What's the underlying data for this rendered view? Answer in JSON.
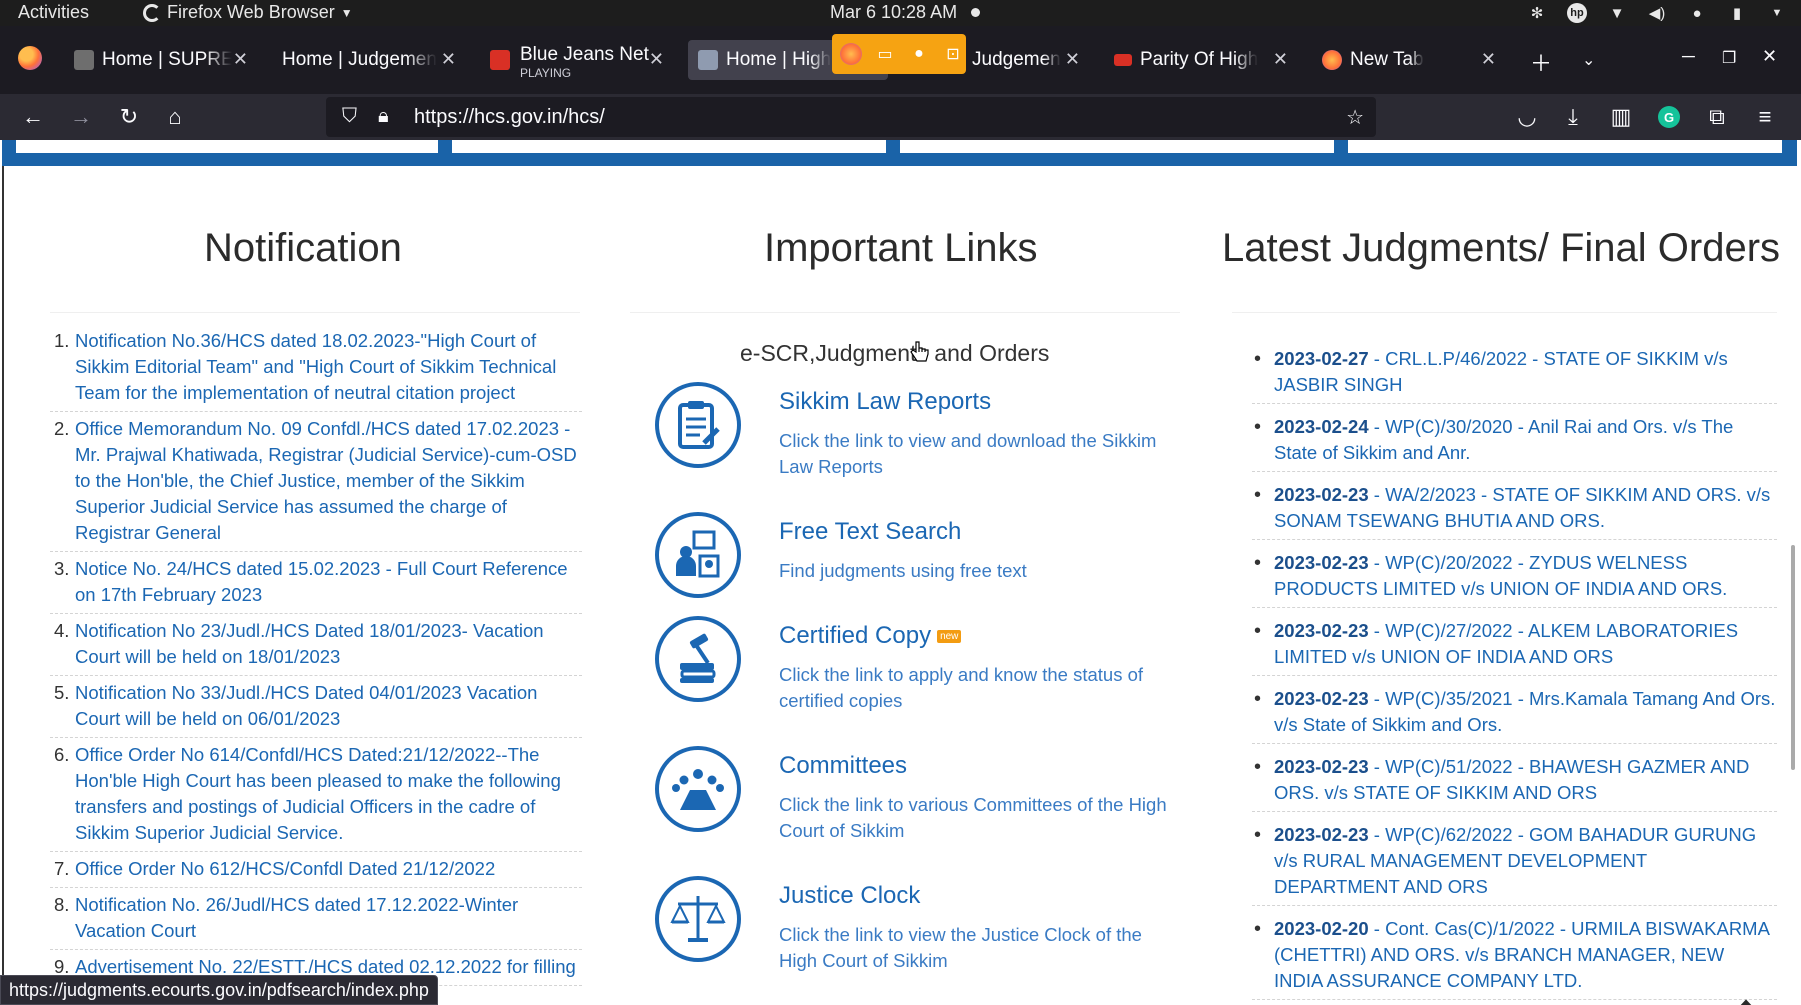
{
  "system": {
    "activities": "Activities",
    "app_name": "Firefox Web Browser",
    "datetime": "Mar 6  10:28 AM"
  },
  "tabs": [
    {
      "title": "Home | SUPREME",
      "favicon_color": "#6e6e6e",
      "active": false
    },
    {
      "title": "Home | Judgemen",
      "favicon_color": "",
      "active": false
    },
    {
      "title": "Blue Jeans Net",
      "subtitle": "PLAYING",
      "favicon_color": "#d93025",
      "active": false
    },
    {
      "title": "Home | High",
      "favicon_color": "#8f9bb0",
      "active": true
    },
    {
      "title": "Judgemen",
      "favicon_color": "",
      "active": false
    },
    {
      "title": "Parity Of High",
      "favicon_color": "#d93025",
      "active": false
    },
    {
      "title": "New Tab",
      "favicon_color": "#ff7139",
      "active": false
    }
  ],
  "navbar": {
    "url": "https://hcs.gov.in/hcs/"
  },
  "sections": {
    "notification_title": "Notification",
    "links_title": "Important Links",
    "judgments_title": "Latest Judgments/ Final Orders"
  },
  "notifications": [
    {
      "num": "1.",
      "text": "Notification No.36/HCS dated 18.02.2023-\"High Court of Sikkim Editorial Team\" and \"High Court of Sikkim Technical Team for the implementation of neutral citation project"
    },
    {
      "num": "2.",
      "text": "Office Memorandum No. 09 Confdl./HCS dated 17.02.2023 - Mr. Prajwal Khatiwada, Registrar (Judicial Service)-cum-OSD to the Hon'ble, the Chief Justice, member of the Sikkim Superior Judicial Service has assumed the charge of Registrar General"
    },
    {
      "num": "3.",
      "text": "Notice No. 24/HCS dated 15.02.2023 - Full Court Reference on 17th February 2023"
    },
    {
      "num": "4.",
      "text": "Notification No 23/Judl./HCS Dated 18/01/2023- Vacation Court will be held on 18/01/2023"
    },
    {
      "num": "5.",
      "text": "Notification No 33/Judl./HCS Dated 04/01/2023 Vacation Court will be held on 06/01/2023"
    },
    {
      "num": "6.",
      "text": "Office Order No 614/Confdl/HCS Dated:21/12/2022--The Hon'ble High Court has been pleased to make the following transfers and postings of Judicial Officers in the cadre of Sikkim Superior Judicial Service."
    },
    {
      "num": "7.",
      "text": "Office Order No 612/HCS/Confdl Dated 21/12/2022"
    },
    {
      "num": "8.",
      "text": "Notification No. 26/Judl/HCS dated 17.12.2022-Winter Vacation Court"
    },
    {
      "num": "9.",
      "text": "Advertisement No. 22/ESTT./HCS dated 02.12.2022 for filling"
    }
  ],
  "important_links": {
    "heading": "e-SCR,Judgments and Orders",
    "items": [
      {
        "title": "Sikkim Law Reports",
        "desc": "Click the link to view and download the Sikkim Law Reports",
        "icon": "document-icon"
      },
      {
        "title": "Free Text Search",
        "desc": "Find judgments using free text",
        "icon": "search-people-icon"
      },
      {
        "title": "Certified Copy",
        "badge": "new",
        "desc": "Click the link to apply and know the status of certified copies",
        "icon": "gavel-books-icon"
      },
      {
        "title": "Committees",
        "desc": "Click the link to various Committees of the High Court of Sikkim",
        "icon": "committee-icon"
      },
      {
        "title": "Justice Clock",
        "desc": "Click the link to view the Justice Clock of the High Court of Sikkim",
        "icon": "scales-icon"
      }
    ]
  },
  "judgments": [
    {
      "date": "2023-02-27",
      "text": " - CRL.L.P/46/2022 - STATE OF SIKKIM v/s JASBIR SINGH"
    },
    {
      "date": "2023-02-24",
      "text": " - WP(C)/30/2020 - Anil Rai and Ors. v/s The State of Sikkim and Anr."
    },
    {
      "date": "2023-02-23",
      "text": " - WA/2/2023 - STATE OF SIKKIM AND ORS. v/s SONAM TSEWANG BHUTIA AND ORS."
    },
    {
      "date": "2023-02-23",
      "text": " - WP(C)/20/2022 - ZYDUS WELNESS PRODUCTS LIMITED v/s UNION OF INDIA AND ORS."
    },
    {
      "date": "2023-02-23",
      "text": " - WP(C)/27/2022 - ALKEM LABORATORIES LIMITED v/s UNION OF INDIA AND ORS"
    },
    {
      "date": "2023-02-23",
      "text": " - WP(C)/35/2021 - Mrs.Kamala Tamang And Ors. v/s State of Sikkim and Ors."
    },
    {
      "date": "2023-02-23",
      "text": " - WP(C)/51/2022 - BHAWESH GAZMER AND ORS. v/s STATE OF SIKKIM AND ORS"
    },
    {
      "date": "2023-02-23",
      "text": " - WP(C)/62/2022 - GOM BAHADUR GURUNG v/s RURAL MANAGEMENT DEVELOPMENT DEPARTMENT AND ORS"
    },
    {
      "date": "2023-02-20",
      "text": " - Cont. Cas(C)/1/2022 - URMILA BISWAKARMA (CHETTRI) AND ORS. v/s BRANCH MANAGER, NEW INDIA ASSURANCE COMPANY LTD."
    }
  ],
  "status_link": "https://judgments.ecourts.gov.in/pdfsearch/index.php",
  "colors": {
    "link_blue": "#1b67b3",
    "band_blue": "#1a63a8",
    "badge_orange": "#f39c12"
  }
}
